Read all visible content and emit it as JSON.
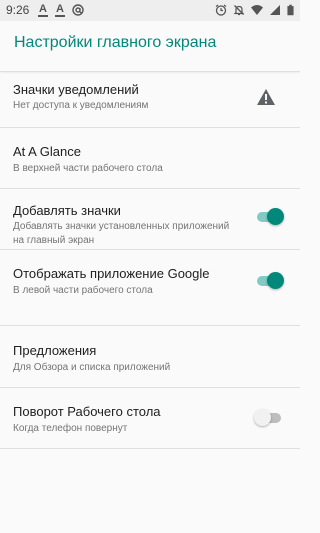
{
  "status_bar": {
    "time": "9:26",
    "left_icons": [
      "text-a-icon",
      "text-a-icon",
      "at-sign-icon"
    ],
    "right_icons": [
      "alarm-icon",
      "notifications-off-icon",
      "wifi-icon",
      "signal-icon",
      "battery-icon"
    ]
  },
  "app_bar": {
    "title": "Настройки главного экрана"
  },
  "colors": {
    "accent": "#00897b",
    "accent_light": "#80cbc4"
  },
  "settings": [
    {
      "title": "Значки уведомлений",
      "subtitle": "Нет доступа к уведомлениям",
      "control": "warning-icon"
    },
    {
      "title": "At A Glance",
      "subtitle": "В верхней части рабочего стола",
      "control": "none"
    },
    {
      "title": "Добавлять значки",
      "subtitle": "Добавлять значки установленных приложений на главный экран",
      "control": "switch",
      "checked": true
    },
    {
      "title": "Отображать приложение Google",
      "subtitle": "В левой части рабочего стола",
      "control": "switch",
      "checked": true
    },
    {
      "title": "Предложения",
      "subtitle": "Для Обзора и списка приложений",
      "control": "none"
    },
    {
      "title": "Поворот Рабочего стола",
      "subtitle": "Когда телефон повернут",
      "control": "switch",
      "checked": false
    }
  ]
}
